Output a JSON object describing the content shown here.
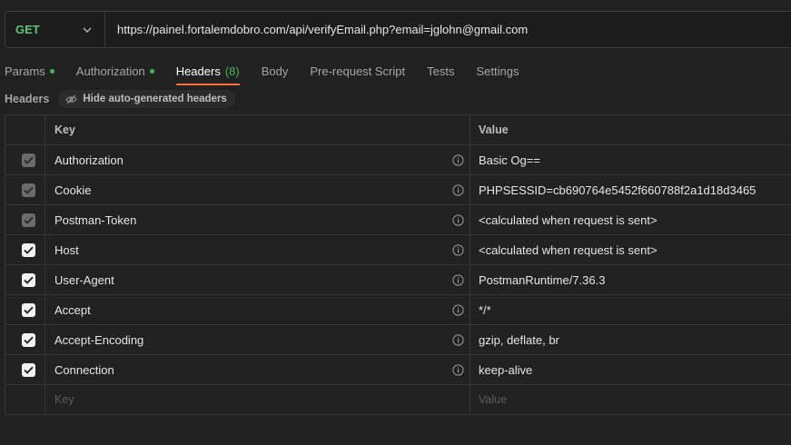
{
  "request": {
    "method": "GET",
    "url": "https://painel.fortalemdobro.com/api/verifyEmail.php?email=jglohn@gmail.com"
  },
  "tabs": [
    {
      "label": "Params",
      "dot": true
    },
    {
      "label": "Authorization",
      "dot": true
    },
    {
      "label": "Headers",
      "count": "(8)",
      "active": true
    },
    {
      "label": "Body"
    },
    {
      "label": "Pre-request Script"
    },
    {
      "label": "Tests"
    },
    {
      "label": "Settings"
    }
  ],
  "headers_section": {
    "title": "Headers",
    "toggle_label": "Hide auto-generated headers"
  },
  "table": {
    "columns": {
      "key": "Key",
      "value": "Value"
    },
    "rows": [
      {
        "key": "Authorization",
        "value": "Basic Og==",
        "checked": true,
        "auto": true
      },
      {
        "key": "Cookie",
        "value": "PHPSESSID=cb690764e5452f660788f2a1d18d3465",
        "checked": true,
        "auto": true
      },
      {
        "key": "Postman-Token",
        "value": "<calculated when request is sent>",
        "checked": true,
        "auto": true
      },
      {
        "key": "Host",
        "value": "<calculated when request is sent>",
        "checked": true,
        "auto": false
      },
      {
        "key": "User-Agent",
        "value": "PostmanRuntime/7.36.3",
        "checked": true,
        "auto": false
      },
      {
        "key": "Accept",
        "value": "*/*",
        "checked": true,
        "auto": false
      },
      {
        "key": "Accept-Encoding",
        "value": "gzip, deflate, br",
        "checked": true,
        "auto": false
      },
      {
        "key": "Connection",
        "value": "keep-alive",
        "checked": true,
        "auto": false
      }
    ],
    "new_row": {
      "key_placeholder": "Key",
      "value_placeholder": "Value"
    }
  },
  "colors": {
    "accent": "#ff6c37",
    "method_get": "#5fc47a",
    "dot": "#3fb950"
  },
  "icons": {
    "method_dropdown": "chevron-down-icon",
    "toggle": "eye-off-icon",
    "row_info": "info-icon",
    "checkbox": "checkbox-icon"
  }
}
